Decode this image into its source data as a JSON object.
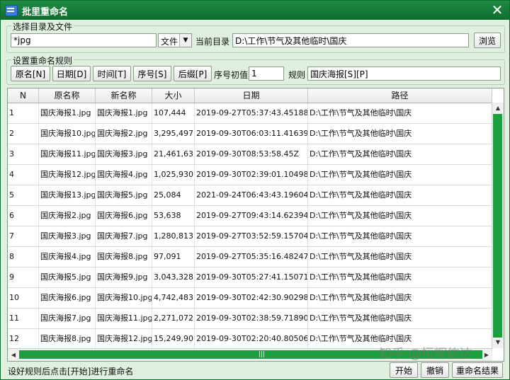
{
  "window": {
    "title": "批里重命名",
    "close": "✕"
  },
  "dir_group": {
    "legend": "选择目录及文件",
    "filter_value": "*jpg",
    "type_select": "文件",
    "current_dir_label": "当前目录",
    "current_dir_value": "D:\\工作\\节气及其他临时\\国庆",
    "browse_label": "浏览"
  },
  "rule_group": {
    "legend": "设置重命名规则",
    "buttons": [
      "原名[N]",
      "日期[D]",
      "时间[T]",
      "序号[S]",
      "后缀[P]"
    ],
    "seq_label": "序号初值",
    "seq_value": "1",
    "rule_label": "规则",
    "rule_value": "国庆海报[S][P]"
  },
  "table": {
    "columns": [
      "N",
      "原名称",
      "新名称",
      "大小",
      "日期",
      "路径"
    ],
    "rows": [
      [
        "1",
        "国庆海报1.jpg",
        "国庆海报1.jpg",
        "107,444",
        "2019-09-27T05:37:43.451885Z",
        "D:\\工作\\节气及其他临时\\国庆"
      ],
      [
        "2",
        "国庆海报10.jpg",
        "国庆海报2.jpg",
        "3,295,497",
        "2019-09-30T06:03:11.416394Z",
        "D:\\工作\\节气及其他临时\\国庆"
      ],
      [
        "3",
        "国庆海报11.jpg",
        "国庆海报3.jpg",
        "21,461,631",
        "2019-09-30T08:53:58.45Z",
        "D:\\工作\\节气及其他临时\\国庆"
      ],
      [
        "4",
        "国庆海报12.jpg",
        "国庆海报4.jpg",
        "1,025,930",
        "2019-09-30T02:39:01.104986Z",
        "D:\\工作\\节气及其他临时\\国庆"
      ],
      [
        "5",
        "国庆海报13.jpg",
        "国庆海报5.jpg",
        "25,084",
        "2021-09-24T06:43:43.196049Z",
        "D:\\工作\\节气及其他临时\\国庆"
      ],
      [
        "6",
        "国庆海报2.jpg",
        "国庆海报6.jpg",
        "53,638",
        "2019-09-27T09:43:14.623947Z",
        "D:\\工作\\节气及其他临时\\国庆"
      ],
      [
        "7",
        "国庆海报3.jpg",
        "国庆海报7.jpg",
        "1,280,813",
        "2019-09-27T03:52:59.157043Z",
        "D:\\工作\\节气及其他临时\\国庆"
      ],
      [
        "8",
        "国庆海报4.jpg",
        "国庆海报8.jpg",
        "97,091",
        "2019-09-27T05:35:16.482479Z",
        "D:\\工作\\节气及其他临时\\国庆"
      ],
      [
        "9",
        "国庆海报5.jpg",
        "国庆海报9.jpg",
        "3,043,328",
        "2019-09-30T05:27:41.150717Z",
        "D:\\工作\\节气及其他临时\\国庆"
      ],
      [
        "10",
        "国庆海报6.jpg",
        "国庆海报10.jpg",
        "4,742,483",
        "2019-09-30T02:42:30.902985Z",
        "D:\\工作\\节气及其他临时\\国庆"
      ],
      [
        "11",
        "国庆海报7.jpg",
        "国庆海报11.jpg",
        "2,271,072",
        "2019-09-30T02:38:59.718906Z",
        "D:\\工作\\节气及其他临时\\国庆"
      ],
      [
        "12",
        "国庆海报8.jpg",
        "国庆海报12.jpg",
        "15,249,907",
        "2019-09-30T02:20:40.805061Z",
        "D:\\工作\\节气及其他临时\\国庆"
      ]
    ]
  },
  "status_text": "设好规则后点击[开始]进行重命名",
  "bottom_buttons": {
    "start": "开始",
    "cancel": "撤销",
    "result": "重命名结果"
  },
  "watermark": "知乎 @恒辉信达"
}
